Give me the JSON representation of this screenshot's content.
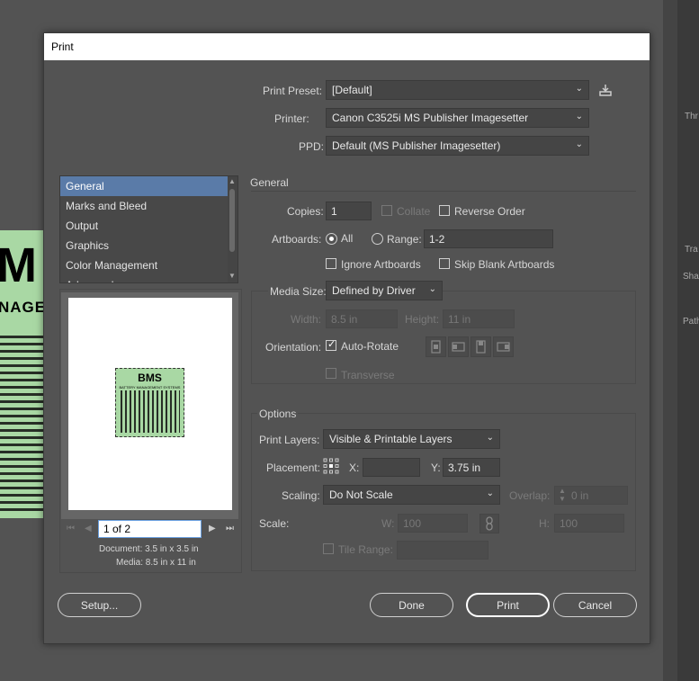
{
  "background": {
    "right_labels": [
      "Thr",
      "Tra",
      "Sha",
      "Path"
    ],
    "art_big": "M",
    "art_small": "NAGEM"
  },
  "dialog": {
    "title": "Print",
    "print_preset": {
      "label": "Print Preset:",
      "value": "[Default]"
    },
    "printer": {
      "label": "Printer:",
      "value": "Canon C3525i MS Publisher Imagesetter"
    },
    "ppd": {
      "label": "PPD:",
      "value": "Default (MS Publisher Imagesetter)"
    },
    "categories": [
      "General",
      "Marks and Bleed",
      "Output",
      "Graphics",
      "Color Management",
      "Advanced"
    ],
    "selected_category": "General",
    "general": {
      "heading": "General",
      "copies_label": "Copies:",
      "copies_value": "1",
      "collate_label": "Collate",
      "reverse_order_label": "Reverse Order",
      "artboards_label": "Artboards:",
      "all_label": "All",
      "range_label": "Range:",
      "range_value": "1-2",
      "ignore_artboards_label": "Ignore Artboards",
      "skip_blank_label": "Skip Blank Artboards",
      "media_size_label": "Media Size:",
      "media_size_value": "Defined by Driver",
      "width_label": "Width:",
      "width_value": "8.5 in",
      "height_label": "Height:",
      "height_value": "11 in",
      "orientation_label": "Orientation:",
      "auto_rotate_label": "Auto-Rotate",
      "transverse_label": "Transverse"
    },
    "options": {
      "heading": "Options",
      "print_layers_label": "Print Layers:",
      "print_layers_value": "Visible & Printable Layers",
      "placement_label": "Placement:",
      "x_label": "X:",
      "x_value": "",
      "y_label": "Y:",
      "y_value": "3.75 in",
      "scaling_label": "Scaling:",
      "scaling_value": "Do Not Scale",
      "overlap_label": "Overlap:",
      "overlap_value": "0 in",
      "scale_label": "Scale:",
      "w_label": "W:",
      "w_value": "100",
      "h_label": "H:",
      "h_value": "100",
      "tile_range_label": "Tile Range:"
    },
    "preview": {
      "page_field": "1 of 2",
      "document": "Document: 3.5 in x 3.5 in",
      "media": "Media: 8.5 in x 11 in",
      "art_title": "BMS",
      "art_subtitle": "BATTERY MANAGEMENT SYSTEMS"
    },
    "buttons": {
      "setup": "Setup...",
      "done": "Done",
      "print": "Print",
      "cancel": "Cancel"
    }
  }
}
